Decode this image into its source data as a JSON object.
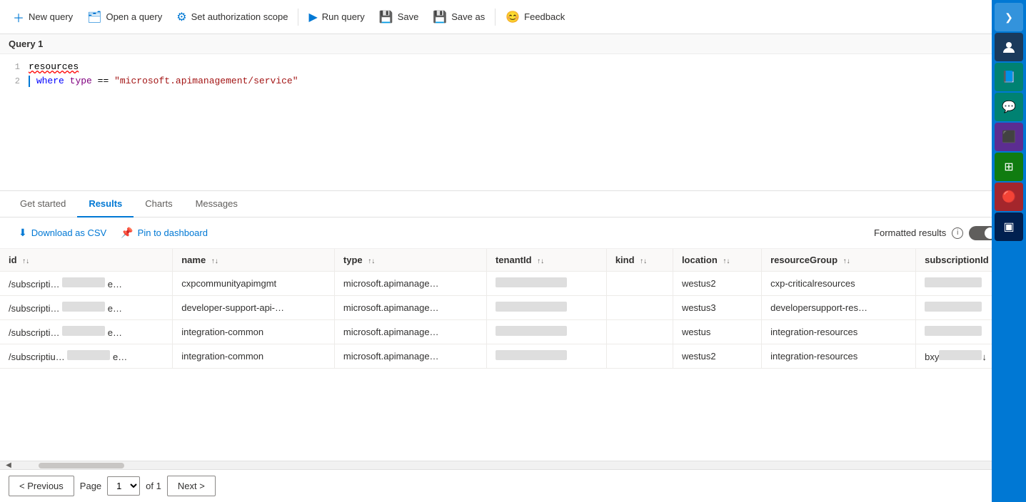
{
  "toolbar": {
    "new_query_label": "New query",
    "open_query_label": "Open a query",
    "set_auth_label": "Set authorization scope",
    "run_query_label": "Run query",
    "save_label": "Save",
    "save_as_label": "Save as",
    "feedback_label": "Feedback"
  },
  "editor": {
    "title": "Query 1",
    "line1": "resources",
    "line2_prefix": "where type == ",
    "line2_string": "\"microsoft.apimanagement/service\""
  },
  "tabs": {
    "items": [
      {
        "label": "Get started",
        "active": false
      },
      {
        "label": "Results",
        "active": true
      },
      {
        "label": "Charts",
        "active": false
      },
      {
        "label": "Messages",
        "active": false
      }
    ]
  },
  "actions": {
    "download_csv_label": "Download as CSV",
    "pin_dashboard_label": "Pin to dashboard",
    "formatted_results_label": "Formatted results",
    "toggle_state": "Off"
  },
  "table": {
    "columns": [
      {
        "key": "id",
        "label": "id"
      },
      {
        "key": "name",
        "label": "name"
      },
      {
        "key": "type",
        "label": "type"
      },
      {
        "key": "tenantId",
        "label": "tenantId"
      },
      {
        "key": "kind",
        "label": "kind"
      },
      {
        "key": "location",
        "label": "location"
      },
      {
        "key": "resourceGroup",
        "label": "resourceGroup"
      },
      {
        "key": "subscriptionId",
        "label": "subscriptionId"
      }
    ],
    "rows": [
      {
        "id": "/subscripti…",
        "id_redacted": true,
        "name_prefix": "cxpcommunityapimgmt",
        "type": "microsoft.apimanage…",
        "tenant_redacted": true,
        "kind": "",
        "location": "westus2",
        "resourceGroup": "cxp-criticalresources",
        "sub_redacted": true
      },
      {
        "id": "/subscripti…",
        "id_redacted": true,
        "name_prefix": "developer-support-api-…",
        "type": "microsoft.apimanage…",
        "tenant_redacted": true,
        "kind": "",
        "location": "westus3",
        "resourceGroup": "developersupport-res…",
        "sub_redacted": true
      },
      {
        "id": "/subscripti…",
        "id_redacted": true,
        "name_prefix": "integration-common",
        "type": "microsoft.apimanage…",
        "tenant_redacted": true,
        "kind": "",
        "location": "westus",
        "resourceGroup": "integration-resources",
        "sub_redacted": true
      },
      {
        "id": "/subscriptiu…",
        "id_redacted": true,
        "name_prefix": "integration-common",
        "type": "microsoft.apimanage…",
        "tenant_redacted": true,
        "kind": "",
        "location": "westus2",
        "resourceGroup": "integration-resources",
        "sub_redacted_last": true
      }
    ]
  },
  "pagination": {
    "prev_label": "< Previous",
    "next_label": "Next >",
    "page_label": "Page",
    "current_page": "1",
    "of_label": "of 1"
  },
  "sidebar": {
    "icons": [
      {
        "name": "chevron-right-icon",
        "symbol": "❯",
        "color_class": "active"
      },
      {
        "name": "user-icon",
        "symbol": "👤",
        "color_class": ""
      },
      {
        "name": "book-icon",
        "symbol": "📘",
        "color_class": "cyan"
      },
      {
        "name": "chat-icon",
        "symbol": "💬",
        "color_class": "cyan"
      },
      {
        "name": "portal-icon",
        "symbol": "⬛",
        "color_class": "purple"
      },
      {
        "name": "grid-icon",
        "symbol": "⊞",
        "color_class": "green"
      },
      {
        "name": "network-icon",
        "symbol": "🔴",
        "color_class": "red"
      },
      {
        "name": "terminal-icon",
        "symbol": "▣",
        "color_class": "navy"
      }
    ]
  }
}
